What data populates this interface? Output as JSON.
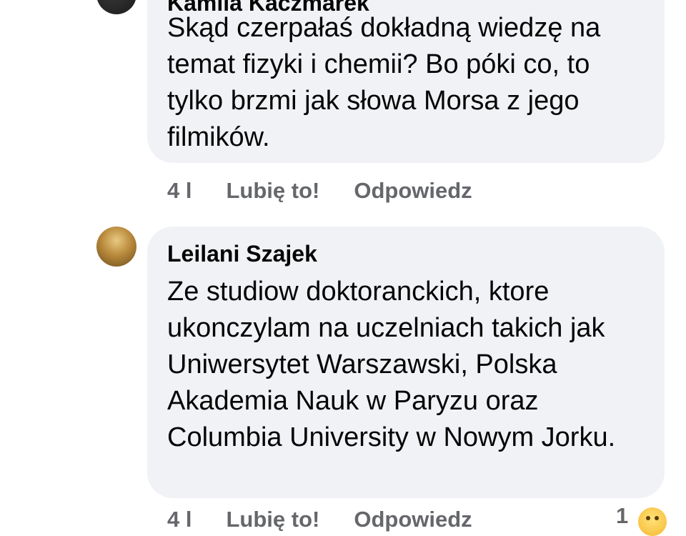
{
  "comments": [
    {
      "author": "Kamila Kaczmarek",
      "text": "Skąd czerpałaś dokładną wiedzę na temat fizyki i chemii? Bo póki co, to tylko brzmi jak słowa Morsa z jego filmików.",
      "time": "4 l",
      "like_label": "Lubię to!",
      "reply_label": "Odpowiedz"
    },
    {
      "author": "Leilani Szajek",
      "text": "Ze studiow doktoranckich, ktore ukonczylam na uczelniach takich jak Uniwersytet Warszawski, Polska Akademia Nauk w Paryzu oraz Columbia University w Nowym Jorku.",
      "time": "4 l",
      "like_label": "Lubię to!",
      "reply_label": "Odpowiedz",
      "reaction_count": "1",
      "reaction_icon": "haha-emoji-icon"
    }
  ]
}
